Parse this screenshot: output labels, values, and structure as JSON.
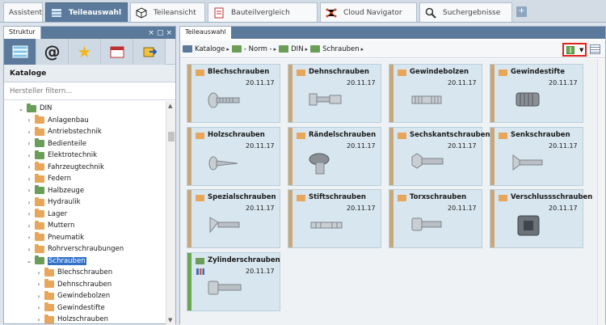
{
  "top_tabs": [
    {
      "label": "Assistent",
      "icon": "none"
    },
    {
      "label": "Teileauswahl",
      "icon": "layers-icon"
    },
    {
      "label": "Teileansicht",
      "icon": "cube-icon"
    },
    {
      "label": "Bauteilvergleich",
      "icon": "document-icon"
    },
    {
      "label": "Cloud Navigator",
      "icon": "network-icon"
    },
    {
      "label": "Suchergebnisse",
      "icon": "search-icon"
    }
  ],
  "tab_plus": "+",
  "left_panel": {
    "title": "Struktur",
    "controls": [
      "×",
      "▢",
      "×"
    ],
    "section_title": "Kataloge",
    "filter_placeholder": "Hersteller filtern...",
    "tree": [
      {
        "label": "DIN",
        "level": 0,
        "expanded": true,
        "color": "green"
      },
      {
        "label": "Anlagenbau",
        "level": 1,
        "color": "orange"
      },
      {
        "label": "Antriebstechnik",
        "level": 1,
        "color": "orange"
      },
      {
        "label": "Bedienteile",
        "level": 1,
        "color": "green"
      },
      {
        "label": "Elektrotechnik",
        "level": 1,
        "color": "green"
      },
      {
        "label": "Fahrzeugtechnik",
        "level": 1,
        "color": "orange"
      },
      {
        "label": "Federn",
        "level": 1,
        "color": "orange"
      },
      {
        "label": "Halbzeuge",
        "level": 1,
        "color": "green"
      },
      {
        "label": "Hydraulik",
        "level": 1,
        "color": "orange"
      },
      {
        "label": "Lager",
        "level": 1,
        "color": "orange"
      },
      {
        "label": "Muttern",
        "level": 1,
        "color": "orange"
      },
      {
        "label": "Pneumatik",
        "level": 1,
        "color": "orange"
      },
      {
        "label": "Rohrverschraubungen",
        "level": 1,
        "color": "orange"
      },
      {
        "label": "Schrauben",
        "level": 1,
        "expanded": true,
        "selected": true,
        "color": "green"
      },
      {
        "label": "Blechschrauben",
        "level": 2,
        "color": "orange"
      },
      {
        "label": "Dehnschrauben",
        "level": 2,
        "color": "orange"
      },
      {
        "label": "Gewindebolzen",
        "level": 2,
        "color": "orange"
      },
      {
        "label": "Gewindestifte",
        "level": 2,
        "color": "orange"
      },
      {
        "label": "Holzschrauben",
        "level": 2,
        "color": "orange"
      }
    ]
  },
  "right_panel": {
    "title": "Teileauswahl",
    "breadcrumb": [
      "Kataloge",
      "- Norm -",
      "DIN",
      "Schrauben"
    ],
    "cards": [
      {
        "name": "Blechschrauben",
        "date": "20.11.17",
        "strip": "orange",
        "shape": "pan-head-screw"
      },
      {
        "name": "Dehnschrauben",
        "date": "20.11.17",
        "strip": "orange",
        "shape": "socket-bolt"
      },
      {
        "name": "Gewindebolzen",
        "date": "20.11.17",
        "strip": "orange",
        "shape": "stud-bolt"
      },
      {
        "name": "Gewindestifte",
        "date": "20.11.17",
        "strip": "orange",
        "shape": "set-screw"
      },
      {
        "name": "Holzschrauben",
        "date": "20.11.17",
        "strip": "orange",
        "shape": "wood-screw"
      },
      {
        "name": "Rändelschrauben",
        "date": "20.11.17",
        "strip": "orange",
        "shape": "knurled-screw"
      },
      {
        "name": "Sechskantschrauben",
        "date": "20.11.17",
        "strip": "orange",
        "shape": "hex-bolt"
      },
      {
        "name": "Senkschrauben",
        "date": "20.11.17",
        "strip": "orange",
        "shape": "countersunk-screw"
      },
      {
        "name": "Spezialschrauben",
        "date": "20.11.17",
        "strip": "orange",
        "shape": "wing-screw"
      },
      {
        "name": "Stiftschrauben",
        "date": "20.11.17",
        "strip": "orange",
        "shape": "stud"
      },
      {
        "name": "Torxschrauben",
        "date": "20.11.17",
        "strip": "orange",
        "shape": "torx-screw"
      },
      {
        "name": "Verschlussschrauben",
        "date": "20.11.17",
        "strip": "orange",
        "shape": "plug-screw"
      },
      {
        "name": "Zylinderschrauben",
        "date": "20.11.17",
        "strip": "green",
        "shape": "cylinder-screw",
        "stats": true
      }
    ]
  }
}
